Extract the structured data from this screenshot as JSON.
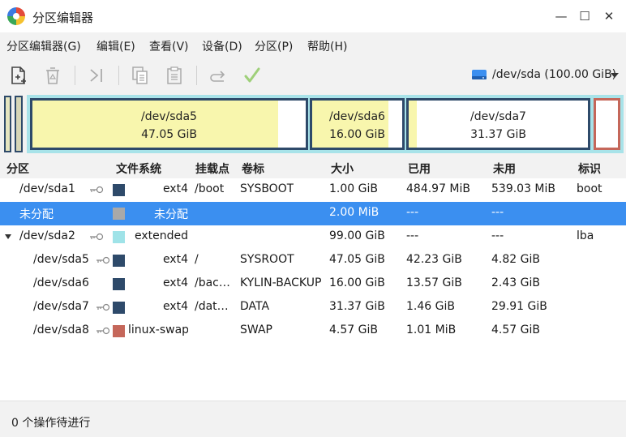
{
  "window": {
    "title": "分区编辑器",
    "minimize_glyph": "—",
    "maximize_glyph": "☐",
    "close_glyph": "✕"
  },
  "menu": {
    "items": [
      "分区编辑器(G)",
      "编辑(E)",
      "查看(V)",
      "设备(D)",
      "分区(P)",
      "帮助(H)"
    ]
  },
  "toolbar": {
    "icons": [
      "new-partition-icon",
      "delete-icon",
      "resize-move-icon",
      "copy-icon",
      "paste-icon",
      "undo-icon",
      "apply-icon"
    ],
    "device": "/dev/sda (100.00 GiB)"
  },
  "disk_map": {
    "partitions": [
      {
        "name": "/dev/sda5",
        "size": "47.05 GiB",
        "used_fraction": 0.898
      },
      {
        "name": "/dev/sda6",
        "size": "16.00 GiB",
        "used_fraction": 0.848
      },
      {
        "name": "/dev/sda7",
        "size": "31.37 GiB",
        "used_fraction": 0.047
      },
      {
        "name": "",
        "size": "",
        "used_fraction": 0
      }
    ]
  },
  "table": {
    "columns": [
      "分区",
      "文件系统",
      "挂载点",
      "卷标",
      "大小",
      "已用",
      "未用",
      "标识"
    ],
    "rows": [
      {
        "partition": "/dev/sda1",
        "fs": "ext4",
        "mount": "/boot",
        "label": "SYSBOOT",
        "size": "1.00 GiB",
        "used": "484.97 MiB",
        "unused": "539.03 MiB",
        "flags": "boot",
        "color": "#2e4a6a",
        "locked": true,
        "level": 0
      },
      {
        "partition": "未分配",
        "fs": "未分配",
        "mount": "",
        "label": "",
        "size": "2.00 MiB",
        "used": "---",
        "unused": "---",
        "flags": "",
        "color": "#a9a9a9",
        "locked": false,
        "level": 0,
        "selected": true
      },
      {
        "partition": "/dev/sda2",
        "fs": "extended",
        "mount": "",
        "label": "",
        "size": "99.00 GiB",
        "used": "---",
        "unused": "---",
        "flags": "lba",
        "color": "#9fe3e8",
        "locked": true,
        "level": 0,
        "expanded": true
      },
      {
        "partition": "/dev/sda5",
        "fs": "ext4",
        "mount": "/",
        "label": "SYSROOT",
        "size": "47.05 GiB",
        "used": "42.23 GiB",
        "unused": "4.82 GiB",
        "flags": "",
        "color": "#2e4a6a",
        "locked": true,
        "level": 1
      },
      {
        "partition": "/dev/sda6",
        "fs": "ext4",
        "mount": "/bac…",
        "label": "KYLIN-BACKUP",
        "size": "16.00 GiB",
        "used": "13.57 GiB",
        "unused": "2.43 GiB",
        "flags": "",
        "color": "#2e4a6a",
        "locked": false,
        "level": 1
      },
      {
        "partition": "/dev/sda7",
        "fs": "ext4",
        "mount": "/dat…",
        "label": "DATA",
        "size": "31.37 GiB",
        "used": "1.46 GiB",
        "unused": "29.91 GiB",
        "flags": "",
        "color": "#2e4a6a",
        "locked": true,
        "level": 1
      },
      {
        "partition": "/dev/sda8",
        "fs": "linux-swap",
        "mount": "",
        "label": "SWAP",
        "size": "4.57 GiB",
        "used": "1.01 MiB",
        "unused": "4.57 GiB",
        "flags": "",
        "color": "#c5675a",
        "locked": true,
        "level": 1
      }
    ]
  },
  "status": {
    "text": "0 个操作待进行"
  }
}
